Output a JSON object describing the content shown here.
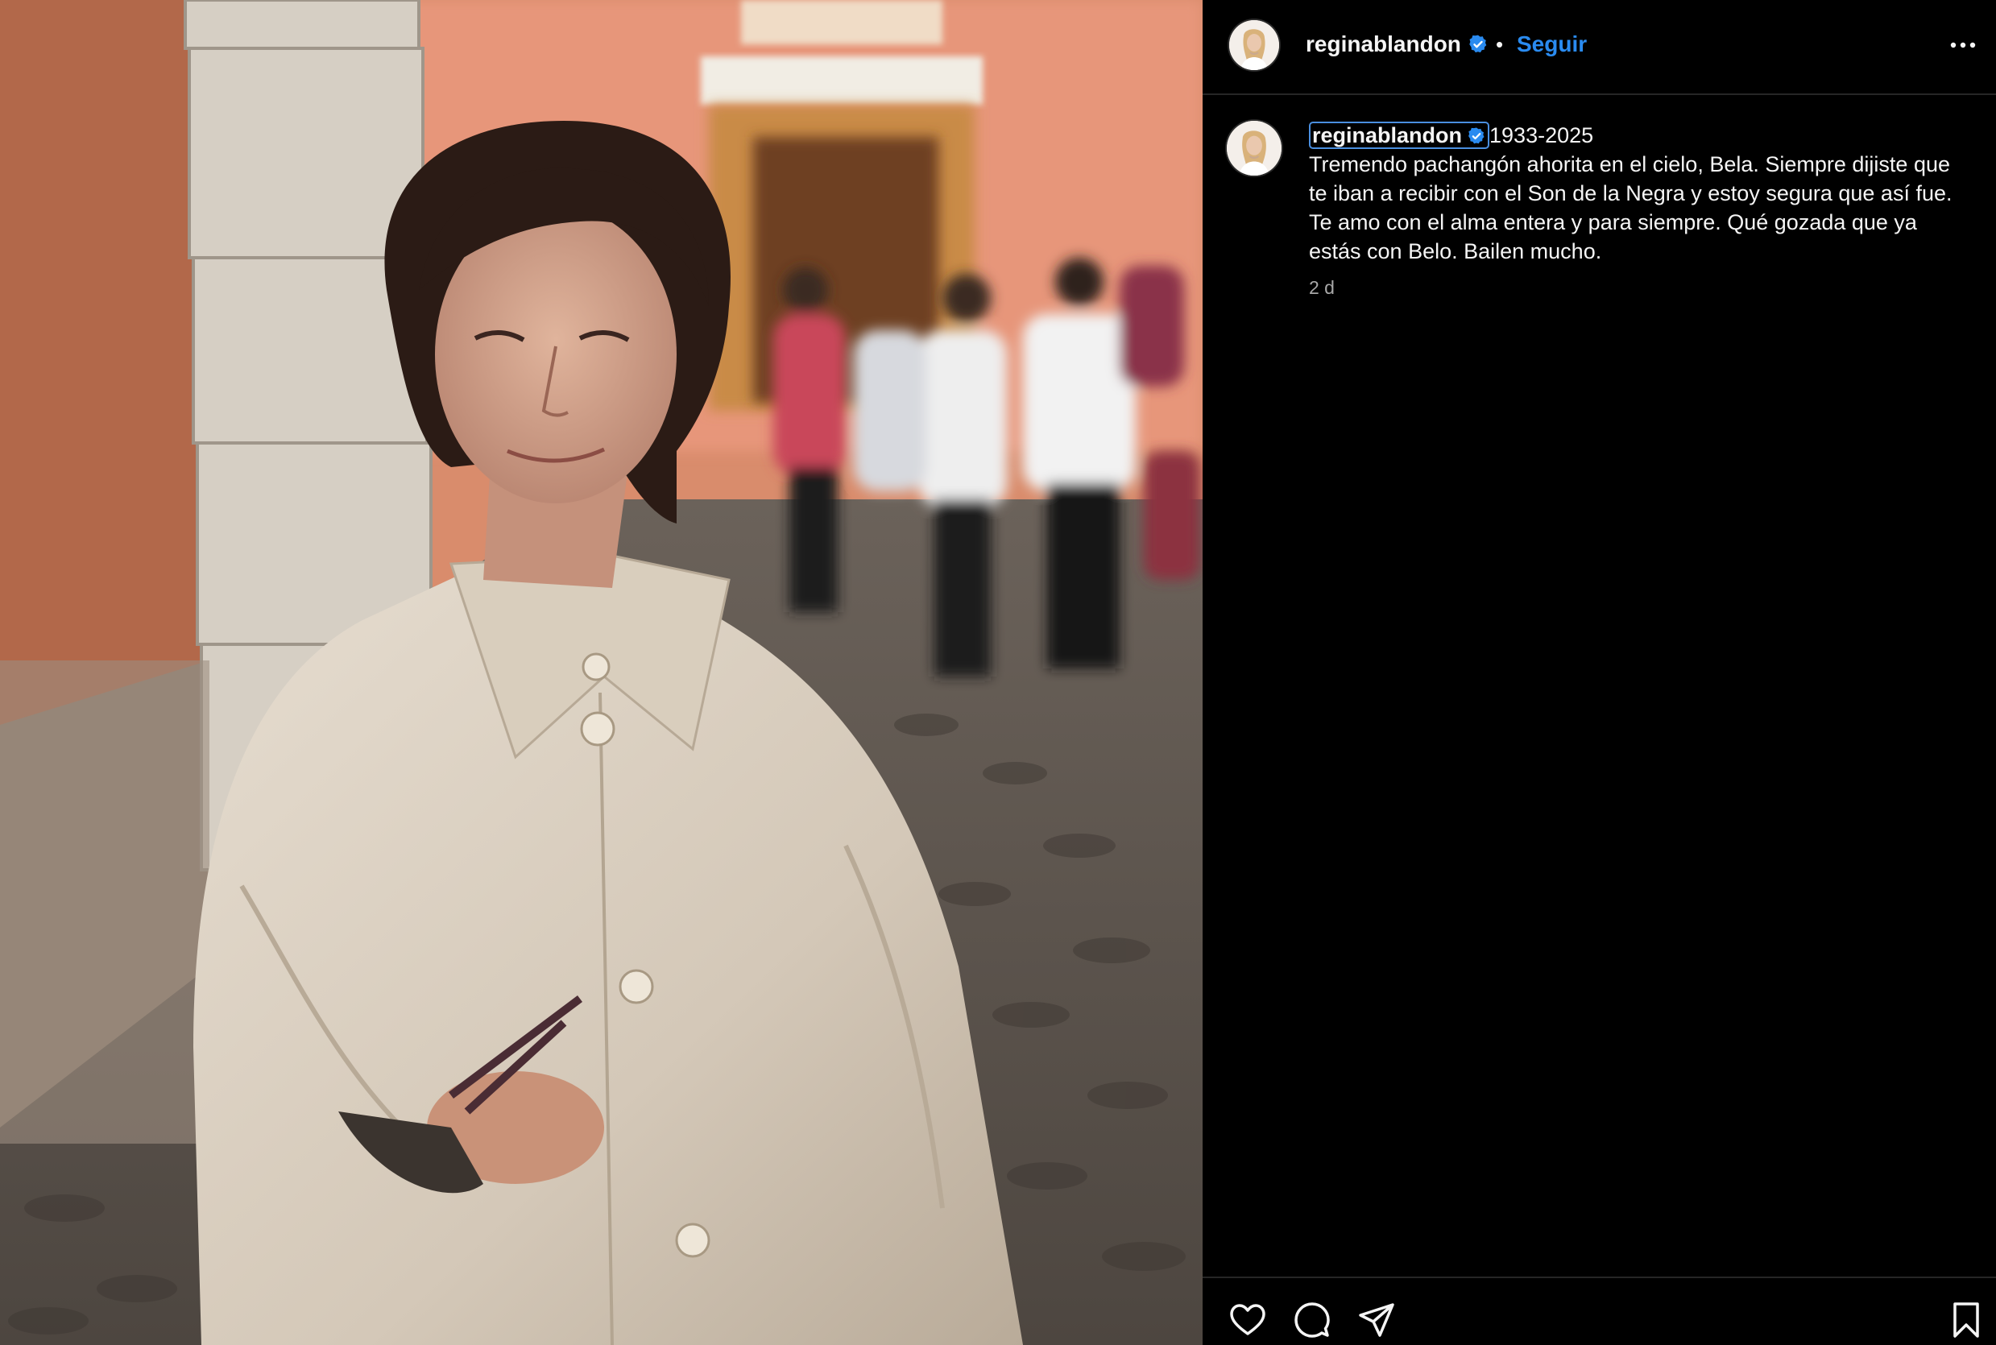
{
  "post": {
    "username": "reginablandon",
    "follow_label": "Seguir",
    "separator": "•",
    "caption_title": "1933-2025",
    "caption_text": "Tremendo pachangón ahorita en el cielo, Bela. Siempre dijiste que te iban a recibir con el Son de la Negra y estoy segura que así fue. Te amo con el alma entera y para siempre. Qué gozada que ya estás con Belo. Bailen mucho.",
    "time_ago": "2 d"
  },
  "icons": {
    "verified": "verified-badge-icon",
    "more": "more-options-icon",
    "like": "heart-icon",
    "comment": "comment-icon",
    "share": "send-icon",
    "save": "bookmark-icon"
  },
  "colors": {
    "background": "#000000",
    "accent_blue": "#2a8bf0",
    "text": "#f5f5f5",
    "muted": "#a8a8a8",
    "divider": "#262626"
  }
}
